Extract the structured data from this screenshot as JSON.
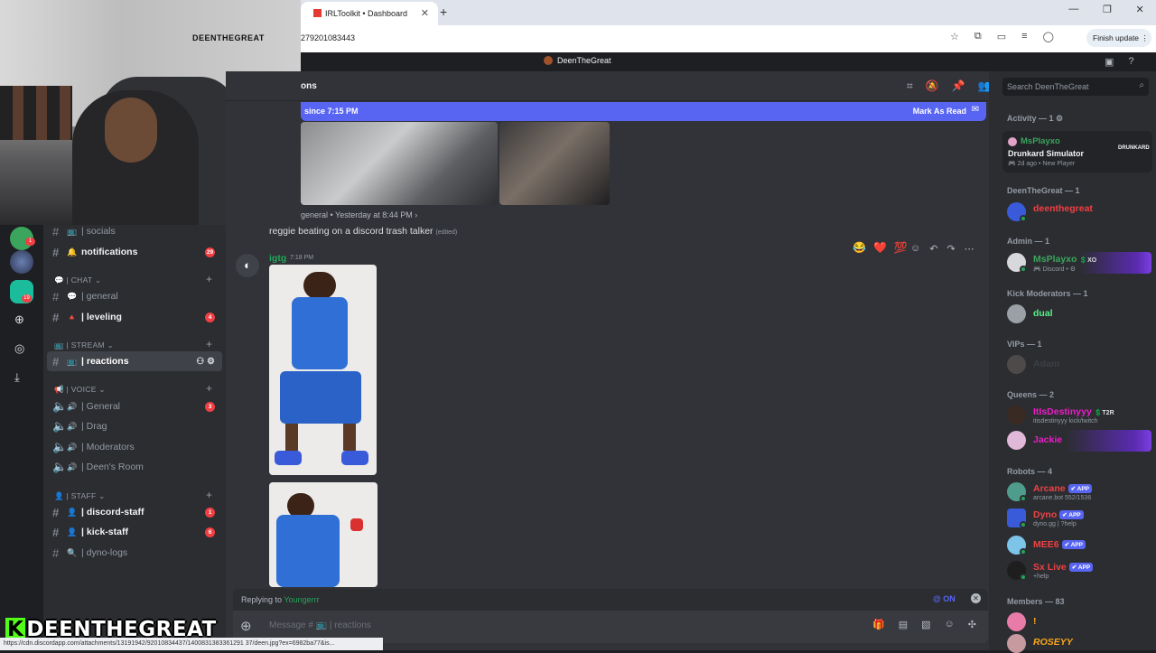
{
  "browser": {
    "tab_title": "IRLToolkit • Dashboard",
    "tab_close": "✕",
    "new_tab": "+",
    "url": "279201083443",
    "finish_update": "Finish update ⋮",
    "window_controls": [
      "—",
      "❐",
      "✕"
    ]
  },
  "webcam": {
    "sign_text": "DEENTHEGREAT"
  },
  "discord": {
    "server_name": "DeenTheGreat",
    "channel_header": "ons",
    "new_messages_banner": "since 7:15 PM",
    "mark_as_read": "Mark As Read",
    "reply_ref": "general • Yesterday at 8:44 PM ›",
    "reggie_message": "reggie beating on a discord trash talker",
    "edited_tag": "(edited)",
    "msg_author": "igtg",
    "msg_time": "7:18 PM",
    "replying_to_label": "Replying to",
    "replying_to_user": "Youngerrr",
    "mention_toggle": "@ ON",
    "composer_placeholder": "Message # 📺 | reactions",
    "search_placeholder": "Search DeenTheGreat"
  },
  "guild_rail": [
    {
      "badge": "1"
    },
    {
      "badge": ""
    },
    {
      "badge": "19"
    }
  ],
  "channels": {
    "items": [
      {
        "emoji": "📺",
        "name": "| socials",
        "badge": "",
        "style": "dim"
      },
      {
        "emoji": "🔔",
        "name": "notifications",
        "badge": "29",
        "style": "bold"
      },
      {
        "emoji": "💬",
        "name": "| general",
        "badge": "",
        "style": "dim"
      },
      {
        "emoji": "🔺",
        "name": "| leveling",
        "badge": "4",
        "style": "bold"
      },
      {
        "emoji": "📺",
        "name": "| reactions",
        "badge": "",
        "style": "active"
      },
      {
        "emoji": "🔊",
        "name": "| General",
        "badge": "3",
        "style": "dim"
      },
      {
        "emoji": "🔊",
        "name": "| Drag",
        "badge": "",
        "style": "dim"
      },
      {
        "emoji": "🔊",
        "name": "| Moderators",
        "badge": "",
        "style": "dim"
      },
      {
        "emoji": "🔊",
        "name": "| Deen's Room",
        "badge": "",
        "style": "dim"
      },
      {
        "emoji": "👤",
        "name": "| discord-staff",
        "badge": "1",
        "style": "bold"
      },
      {
        "emoji": "👤",
        "name": "| kick-staff",
        "badge": "6",
        "style": "bold"
      },
      {
        "emoji": "🔍",
        "name": "| dyno-logs",
        "badge": "",
        "style": "dim"
      }
    ],
    "categories": [
      "💬 | CHAT",
      "📺 | STREAM",
      "📢 | VOICE",
      "👤 | STAFF"
    ]
  },
  "members": {
    "groups": {
      "activity": "Activity — 1 ⚙",
      "deen": "DeenTheGreat — 1",
      "admin": "Admin — 1",
      "kickmods": "Kick Moderators — 1",
      "vips": "VIPs — 1",
      "queens": "Queens — 2",
      "robots": "Robots — 4",
      "members": "Members — 83"
    },
    "activity": {
      "name": "MsPlayxo",
      "game": "Drunkard Simulator",
      "detail": "🎮 2d ago • New Player",
      "logo": "DRUNKARD"
    },
    "list": [
      {
        "name": "deenthegreat",
        "sub": "",
        "color": "#f23f43"
      },
      {
        "name": "MsPlayxo",
        "sub": "🎮 Discord • ⚙",
        "color": "#3ba55d",
        "tag": "💲XO"
      },
      {
        "name": "dual",
        "sub": "",
        "color": "#57f287"
      },
      {
        "name": "Adam",
        "sub": "",
        "color": "#3d3f45"
      },
      {
        "name": "ItIsDestinyyy",
        "sub": "itisdestinyyy kick/twitch",
        "color": "#e91ec6",
        "tag": "💲T2R"
      },
      {
        "name": "Jackie",
        "sub": "",
        "color": "#e91ec6"
      },
      {
        "name": "Arcane",
        "sub": "arcane.bot 552/1536",
        "color": "#ed4245",
        "app": "✔ APP"
      },
      {
        "name": "Dyno",
        "sub": "dyno.gg | ?help",
        "color": "#ed4245",
        "app": "✔ APP"
      },
      {
        "name": "MEE6",
        "sub": "",
        "color": "#ed4245",
        "app": "✔ APP"
      },
      {
        "name": "Sx Live",
        "sub": "+help",
        "color": "#ed4245",
        "app": "✔ APP"
      },
      {
        "name": "!",
        "sub": "",
        "color": "#faa61a"
      },
      {
        "name": "ROSEYY",
        "sub": "",
        "color": "#faa61a"
      }
    ]
  },
  "overlay": {
    "name": "DEENTHEGREAT",
    "k": "K"
  },
  "status_url": "https://cdn.discordapp.com/attachments/13191942/92010834437/1400831383361291 37/deen.jpg?ex=6982ba77&is..."
}
